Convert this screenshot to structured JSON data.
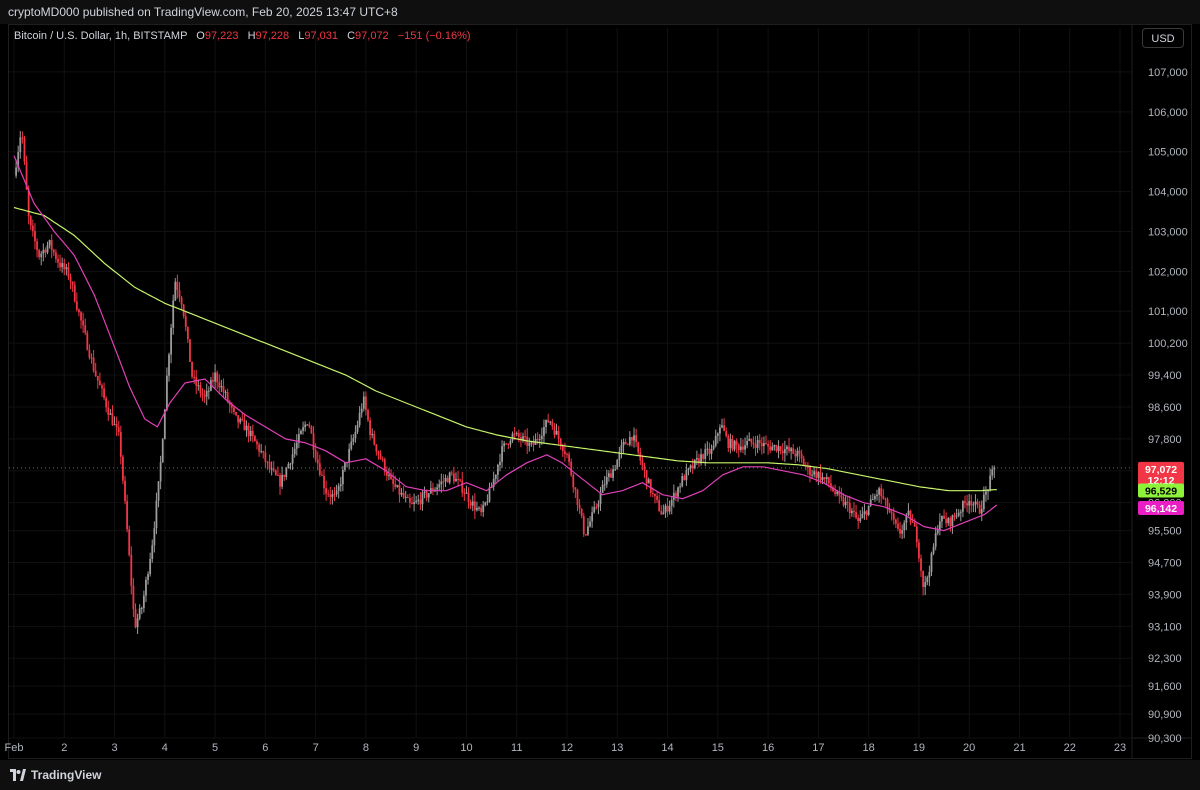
{
  "publish_bar": {
    "text": "cryptoMD000 published on TradingView.com, Feb 20, 2025 13:47 UTC+8"
  },
  "legend": {
    "symbol": "Bitcoin / U.S. Dollar, 1h, BITSTAMP",
    "o_label": "O",
    "o_value": "97,223",
    "h_label": "H",
    "h_value": "97,228",
    "l_label": "L",
    "l_value": "97,031",
    "c_label": "C",
    "c_value": "97,072",
    "change": "−151 (−0.16%)"
  },
  "currency_button": {
    "label": "USD"
  },
  "footer": {
    "brand": "TradingView"
  },
  "colors": {
    "up": "#9c9c9c",
    "down": "#f23645",
    "ma_long": "#c6f46a",
    "ma_short": "#e040b8",
    "grid": "#111111",
    "axis_text": "#b2b5be"
  },
  "chart_data": {
    "type": "candlestick",
    "title": "Bitcoin / U.S. Dollar, 1h, BITSTAMP",
    "ylim": [
      90300,
      107600
    ],
    "y_ticks": [
      107000,
      106000,
      105000,
      104000,
      103000,
      102000,
      101000,
      100200,
      99400,
      98600,
      97800,
      97000,
      96200,
      95500,
      94700,
      93900,
      93100,
      92300,
      91600,
      90900,
      90300
    ],
    "y_tick_labels": [
      "107,000",
      "106,000",
      "105,000",
      "104,000",
      "103,000",
      "102,000",
      "101,000",
      "100,200",
      "99,400",
      "98,600",
      "97,800",
      "97,000",
      "96,200",
      "95,500",
      "94,700",
      "93,900",
      "93,100",
      "92,300",
      "91,600",
      "90,900",
      "90,300"
    ],
    "x_ticks": [
      1,
      2,
      3,
      4,
      5,
      6,
      7,
      8,
      9,
      10,
      11,
      12,
      13,
      14,
      15,
      16,
      17,
      18,
      19,
      20,
      21,
      22,
      23
    ],
    "x_tick_labels": [
      "Feb",
      "2",
      "3",
      "4",
      "5",
      "6",
      "7",
      "8",
      "9",
      "10",
      "11",
      "12",
      "13",
      "14",
      "15",
      "16",
      "17",
      "18",
      "19",
      "20",
      "21",
      "22",
      "23"
    ],
    "xlim": [
      1,
      23
    ],
    "current_price": {
      "value": 97072,
      "label": "97,072",
      "countdown": "12:12"
    },
    "ma_long_last": {
      "value": 96529,
      "label": "96,529"
    },
    "ma_short_last": {
      "value": 96142,
      "label": "96,142"
    },
    "price_anchors_day_value": [
      [
        1.0,
        104400
      ],
      [
        1.15,
        105600
      ],
      [
        1.3,
        103200
      ],
      [
        1.5,
        102400
      ],
      [
        1.7,
        102700
      ],
      [
        1.9,
        102200
      ],
      [
        2.1,
        101900
      ],
      [
        2.3,
        100900
      ],
      [
        2.6,
        99500
      ],
      [
        2.85,
        98600
      ],
      [
        3.1,
        97800
      ],
      [
        3.25,
        95500
      ],
      [
        3.4,
        93100
      ],
      [
        3.55,
        93600
      ],
      [
        3.75,
        95200
      ],
      [
        3.9,
        96900
      ],
      [
        4.05,
        99500
      ],
      [
        4.2,
        101800
      ],
      [
        4.35,
        101200
      ],
      [
        4.55,
        99300
      ],
      [
        4.8,
        98800
      ],
      [
        5.0,
        99400
      ],
      [
        5.2,
        98900
      ],
      [
        5.4,
        98300
      ],
      [
        5.6,
        98100
      ],
      [
        5.9,
        97500
      ],
      [
        6.1,
        97000
      ],
      [
        6.3,
        96700
      ],
      [
        6.5,
        97300
      ],
      [
        6.7,
        97900
      ],
      [
        6.85,
        98300
      ],
      [
        7.0,
        97400
      ],
      [
        7.2,
        96500
      ],
      [
        7.4,
        96300
      ],
      [
        7.6,
        97200
      ],
      [
        7.8,
        98000
      ],
      [
        7.95,
        98800
      ],
      [
        8.1,
        97900
      ],
      [
        8.3,
        97300
      ],
      [
        8.5,
        96700
      ],
      [
        8.7,
        96400
      ],
      [
        8.9,
        96100
      ],
      [
        9.1,
        96300
      ],
      [
        9.3,
        96500
      ],
      [
        9.5,
        96700
      ],
      [
        9.7,
        96900
      ],
      [
        9.9,
        96600
      ],
      [
        10.1,
        96200
      ],
      [
        10.3,
        95900
      ],
      [
        10.5,
        96600
      ],
      [
        10.7,
        97500
      ],
      [
        10.9,
        97900
      ],
      [
        11.1,
        97800
      ],
      [
        11.3,
        97600
      ],
      [
        11.5,
        98000
      ],
      [
        11.65,
        98300
      ],
      [
        11.8,
        97900
      ],
      [
        12.0,
        97400
      ],
      [
        12.2,
        96300
      ],
      [
        12.35,
        95400
      ],
      [
        12.55,
        96000
      ],
      [
        12.75,
        96700
      ],
      [
        12.95,
        97100
      ],
      [
        13.1,
        97600
      ],
      [
        13.3,
        97900
      ],
      [
        13.5,
        97100
      ],
      [
        13.7,
        96400
      ],
      [
        13.9,
        95900
      ],
      [
        14.1,
        96300
      ],
      [
        14.3,
        96800
      ],
      [
        14.5,
        97100
      ],
      [
        14.7,
        97400
      ],
      [
        14.9,
        97500
      ],
      [
        15.05,
        98200
      ],
      [
        15.2,
        97700
      ],
      [
        15.4,
        97600
      ],
      [
        15.6,
        97700
      ],
      [
        15.8,
        97700
      ],
      [
        16.0,
        97600
      ],
      [
        16.2,
        97600
      ],
      [
        16.4,
        97500
      ],
      [
        16.6,
        97400
      ],
      [
        16.8,
        97000
      ],
      [
        17.0,
        96900
      ],
      [
        17.2,
        96700
      ],
      [
        17.4,
        96300
      ],
      [
        17.6,
        96100
      ],
      [
        17.8,
        95700
      ],
      [
        18.0,
        96100
      ],
      [
        18.2,
        96500
      ],
      [
        18.4,
        96000
      ],
      [
        18.6,
        95400
      ],
      [
        18.8,
        95900
      ],
      [
        18.95,
        95400
      ],
      [
        19.1,
        94000
      ],
      [
        19.25,
        94800
      ],
      [
        19.4,
        95800
      ],
      [
        19.6,
        95700
      ],
      [
        19.8,
        96000
      ],
      [
        20.0,
        96300
      ],
      [
        20.2,
        96000
      ],
      [
        20.35,
        96500
      ],
      [
        20.5,
        97072
      ]
    ],
    "ma_long_anchors_day_value": [
      [
        1.0,
        103600
      ],
      [
        1.6,
        103400
      ],
      [
        2.2,
        102900
      ],
      [
        2.8,
        102200
      ],
      [
        3.4,
        101600
      ],
      [
        4.0,
        101200
      ],
      [
        4.6,
        100900
      ],
      [
        5.2,
        100600
      ],
      [
        5.8,
        100300
      ],
      [
        6.4,
        100000
      ],
      [
        7.0,
        99700
      ],
      [
        7.6,
        99400
      ],
      [
        8.2,
        99000
      ],
      [
        8.8,
        98700
      ],
      [
        9.4,
        98400
      ],
      [
        10.0,
        98100
      ],
      [
        10.6,
        97900
      ],
      [
        11.2,
        97750
      ],
      [
        11.8,
        97650
      ],
      [
        12.4,
        97550
      ],
      [
        13.0,
        97450
      ],
      [
        13.6,
        97350
      ],
      [
        14.2,
        97250
      ],
      [
        14.8,
        97200
      ],
      [
        15.4,
        97200
      ],
      [
        16.0,
        97200
      ],
      [
        16.6,
        97150
      ],
      [
        17.2,
        97050
      ],
      [
        17.8,
        96900
      ],
      [
        18.4,
        96750
      ],
      [
        19.0,
        96600
      ],
      [
        19.6,
        96500
      ],
      [
        20.2,
        96500
      ],
      [
        20.55,
        96529
      ]
    ],
    "ma_short_anchors_day_value": [
      [
        1.0,
        104900
      ],
      [
        1.4,
        103700
      ],
      [
        1.8,
        103000
      ],
      [
        2.2,
        102400
      ],
      [
        2.6,
        101400
      ],
      [
        3.0,
        100100
      ],
      [
        3.3,
        99100
      ],
      [
        3.6,
        98300
      ],
      [
        3.85,
        98100
      ],
      [
        4.1,
        98700
      ],
      [
        4.4,
        99200
      ],
      [
        4.8,
        99300
      ],
      [
        5.2,
        98800
      ],
      [
        5.6,
        98400
      ],
      [
        6.0,
        98100
      ],
      [
        6.4,
        97800
      ],
      [
        6.8,
        97700
      ],
      [
        7.2,
        97500
      ],
      [
        7.6,
        97200
      ],
      [
        8.0,
        97300
      ],
      [
        8.4,
        97000
      ],
      [
        8.8,
        96600
      ],
      [
        9.2,
        96500
      ],
      [
        9.6,
        96500
      ],
      [
        10.0,
        96700
      ],
      [
        10.4,
        96500
      ],
      [
        10.8,
        96900
      ],
      [
        11.2,
        97200
      ],
      [
        11.6,
        97400
      ],
      [
        11.9,
        97200
      ],
      [
        12.3,
        96800
      ],
      [
        12.7,
        96400
      ],
      [
        13.1,
        96500
      ],
      [
        13.5,
        96700
      ],
      [
        13.9,
        96400
      ],
      [
        14.3,
        96300
      ],
      [
        14.7,
        96500
      ],
      [
        15.1,
        96900
      ],
      [
        15.5,
        97100
      ],
      [
        15.9,
        97100
      ],
      [
        16.3,
        97000
      ],
      [
        16.7,
        96900
      ],
      [
        17.1,
        96700
      ],
      [
        17.5,
        96400
      ],
      [
        17.9,
        96200
      ],
      [
        18.3,
        96100
      ],
      [
        18.7,
        95900
      ],
      [
        19.1,
        95600
      ],
      [
        19.5,
        95500
      ],
      [
        19.9,
        95700
      ],
      [
        20.3,
        95900
      ],
      [
        20.55,
        96142
      ]
    ]
  }
}
